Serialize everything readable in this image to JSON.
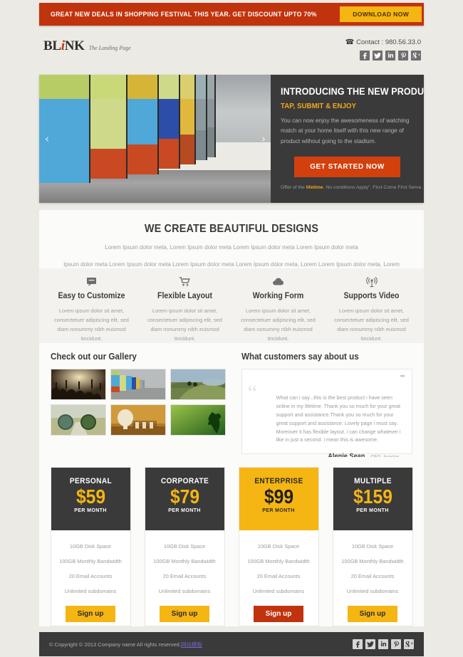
{
  "promo": {
    "text": "GREAT NEW DEALS IN SHOPPING FESTIVAL THIS YEAR. GET DISCOUNT UPTO 70%",
    "button_label": "DOWNLOAD NOW",
    "bg_color": "#c1330d",
    "button_color": "#f5b513"
  },
  "header": {
    "logo_main": "BL",
    "logo_i": "i",
    "logo_end": "NK",
    "logo_sub": "The Landing Page",
    "phone_icon": "telephone-icon",
    "contact": "Contact : 980.56.33.0",
    "socials": [
      {
        "name": "facebook",
        "glyph": "f"
      },
      {
        "name": "twitter",
        "glyph": "t"
      },
      {
        "name": "linkedin",
        "glyph": "in"
      },
      {
        "name": "pinterest",
        "glyph": "p"
      },
      {
        "name": "google-plus",
        "glyph": "g+"
      }
    ]
  },
  "hero": {
    "title": "INTRODUCING THE NEW PRODUCT",
    "subtitle": "TAP, SUBMIT & ENJOY",
    "body": "You can now enjoy the awesomeness of watching match at your home itself with this new range of product without going to the stadium.",
    "button_label": "GET STARTED NOW",
    "offer_prefix": "Offer of the ",
    "offer_highlight": "lifetime",
    "offer_suffix": ". No conditions Apply\". First Come First Serve.",
    "prev_arrow": "‹",
    "next_arrow": "›",
    "accent_color": "#f0a81e",
    "button_color": "#d2400e",
    "pane_color": "#3a3a3a"
  },
  "intro": {
    "heading": "WE CREATE BEAUTIFUL DESIGNS",
    "line1": "Lorem Ipsum dolor meta, Lorem Ipsum dolor meta Lorem Ipsum dolor meta Lorem Ipsum dolor meta",
    "line2": "Ipsum dolor meta Lorem Ipsum dolor meta Lorem Ipsum dolor meta Lorem Ipsum dolor meta, Lorem Lorem Ipsum dolor meta, Lorem"
  },
  "features": [
    {
      "icon": "comment-bubble-icon",
      "title": "Easy to Customize",
      "text": "Lorem ipsum dolor sit amet, consectetuer adipiscing elit, sed diam nonummy nibh euismod tincidunt."
    },
    {
      "icon": "shopping-cart-icon",
      "title": "Flexible Layout",
      "text": "Lorem ipsum dolor sit amet, consectetuer adipiscing elit, sed diam nonummy nibh euismod tincidunt."
    },
    {
      "icon": "cloud-icon",
      "title": "Working Form",
      "text": "Lorem ipsum dolor sit amet, consectetuer adipiscing elit, sed diam nonummy nibh euismod tincidunt."
    },
    {
      "icon": "broadcast-tower-icon",
      "title": "Supports Video",
      "text": "Lorem ipsum dolor sit amet, consectetuer adipiscing elit, sed diam nonummy nibh euismod tincidunt."
    }
  ],
  "gallery": {
    "title": "Check out our Gallery",
    "items": [
      {
        "name": "crowd-concert-photo"
      },
      {
        "name": "beach-huts-photo"
      },
      {
        "name": "mountain-bikers-photo"
      },
      {
        "name": "road-lenses-photo"
      },
      {
        "name": "wooden-interior-photo"
      },
      {
        "name": "green-abstract-photo"
      }
    ]
  },
  "testimonial": {
    "title": "What customers say about us",
    "nav": "◂▸",
    "quote_mark": "“",
    "text": "What can i say...this is the best product i have seen online in my lifetime. Thank you so much for your great support and assistance.Thank you so much for your great support and assistance. Lovely page i must say. Moreover it has flexible layout, i can change whatever i like in just a second. i mean this is awesome.",
    "author_name": "Alenie Sean",
    "author_role": "CEO ,Acestar"
  },
  "pricing": {
    "plans": [
      {
        "name": "PERSONAL",
        "price": "$59",
        "period": "PER MONTH",
        "header_style": "dark",
        "button_style": "gold",
        "button_label": "Sign up",
        "features": [
          "10GB Disk Space",
          "100GB Monthly Bandwidth",
          "20 Email Accounts",
          "Unlimited subdomains"
        ]
      },
      {
        "name": "CORPORATE",
        "price": "$79",
        "period": "PER MONTH",
        "header_style": "dark",
        "button_style": "gold",
        "button_label": "Sign up",
        "features": [
          "10GB Disk Space",
          "100GB Monthly Bandwidth",
          "20 Email Accounts",
          "Unlimited subdomains"
        ]
      },
      {
        "name": "ENTERPRISE",
        "price": "$99",
        "period": "PER MONTH",
        "header_style": "gold",
        "button_style": "red",
        "button_label": "Sign up",
        "features": [
          "10GB Disk Space",
          "100GB Monthly Bandwidth",
          "20 Email Accounts",
          "Unlimited subdomains"
        ]
      },
      {
        "name": "MULTIPLE",
        "price": "$159",
        "period": "PER MONTH",
        "header_style": "dark",
        "button_style": "gold",
        "button_label": "Sign up",
        "features": [
          "10GB Disk Space",
          "100GB Monthly Bandwidth",
          "20 Email Accounts",
          "Unlimited subdomains"
        ]
      }
    ]
  },
  "footer": {
    "copyright": "© Copyright © 2013 Company name All rights reserved.",
    "link_text": "网站模板",
    "socials": [
      {
        "name": "facebook",
        "glyph": "f"
      },
      {
        "name": "twitter",
        "glyph": "t"
      },
      {
        "name": "linkedin",
        "glyph": "in"
      },
      {
        "name": "pinterest",
        "glyph": "p"
      },
      {
        "name": "google-plus",
        "glyph": "g+"
      }
    ]
  }
}
